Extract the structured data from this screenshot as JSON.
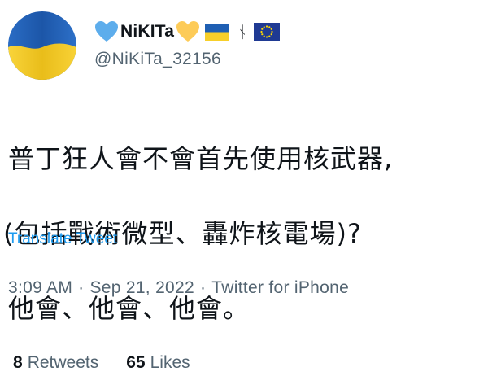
{
  "user": {
    "display_name": "NiKITa",
    "handle": "@NiKiTa_32156",
    "rune_glyph": "ᚾ",
    "icons": [
      "blue-heart-icon",
      "yellow-heart-icon",
      "ukraine-flag-icon",
      "rune-icon",
      "eu-flag-icon"
    ]
  },
  "tweet": {
    "line1": "普丁狂人會不會首先使用核武器,",
    "line2": "(包括戰術微型、轟炸核電場)?",
    "line3": "他會、他會、他會。",
    "translate_label": "Translate Tweet"
  },
  "meta": {
    "time": "3:09 AM",
    "separator": "·",
    "date": "Sep 21, 2022",
    "source": "Twitter for iPhone"
  },
  "stats": {
    "retweets_count": "8",
    "retweets_label": "Retweets",
    "likes_count": "65",
    "likes_label": "Likes"
  },
  "colors": {
    "ukraine_blue": "#1f5fb3",
    "ukraine_yellow": "#f7cf2a",
    "heart_blue": "#5dadec",
    "heart_yellow": "#fdcb58",
    "link_blue": "#1d9bf0",
    "secondary_text": "#536471"
  }
}
